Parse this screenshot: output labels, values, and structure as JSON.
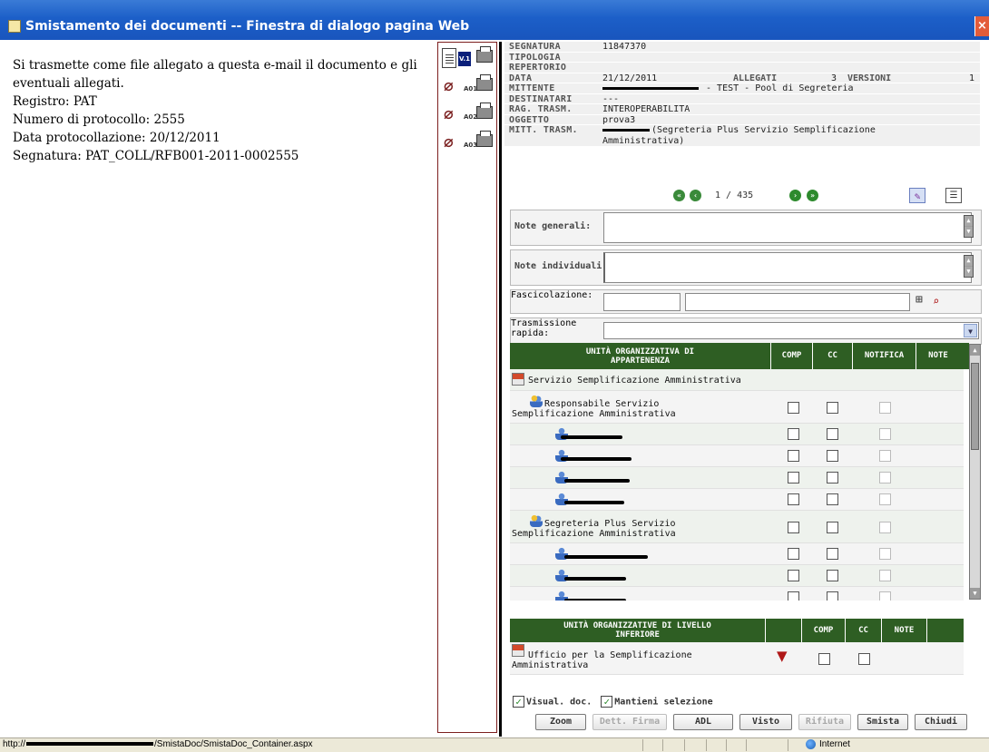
{
  "window": {
    "title": "Smistamento dei documenti -- Finestra di dialogo pagina Web",
    "close_glyph": "×"
  },
  "document": {
    "lines": [
      "Si trasmette come file allegato a questa e-mail il documento e gli",
      "eventuali allegati.",
      "Registro: PAT",
      "Numero di protocollo: 2555",
      "Data protocollazione: 20/12/2011",
      "Segnatura: PAT_COLL/RFB001-2011-0002555"
    ]
  },
  "attachments": [
    {
      "label": "V.1"
    },
    {
      "label": "A01"
    },
    {
      "label": "A02"
    },
    {
      "label": "A03"
    }
  ],
  "meta": {
    "segnatura_k": "SEGNATURA",
    "segnatura_v": "11847370",
    "tipologia_k": "TIPOLOGIA",
    "repertorio_k": "REPERTORIO",
    "data_k": "DATA",
    "data_v": "21/12/2011",
    "allegati_k": "ALLEGATI",
    "allegati_v": "3",
    "versioni_k": "VERSIONI",
    "versioni_v": "1",
    "mittente_k": "MITTENTE",
    "mittente_v": " - TEST - Pool di Segreteria",
    "destinatari_k": "DESTINATARI",
    "destinatari_v": "---",
    "ragtrasm_k": "RAG. TRASM.",
    "ragtrasm_v": "INTEROPERABILITA",
    "oggetto_k": "OGGETTO",
    "oggetto_v": "prova3",
    "mitttrasm_k": "MITT. TRASM.",
    "mitttrasm_v1": "(Segreteria Plus Servizio Semplificazione",
    "mitttrasm_v2": "Amministrativa)"
  },
  "nav": {
    "first": "«",
    "prev": "‹",
    "count": "1 / 435",
    "next": "›",
    "last": "»"
  },
  "form": {
    "note_generali": "Note generali:",
    "note_individuali": "Note individuali:",
    "fascicolazione": "Fascicolazione:",
    "trasmissione_rapida_1": "Trasmissione",
    "trasmissione_rapida_2": "rapida:"
  },
  "grid1": {
    "headers": {
      "unit_1": "UNITÀ ORGANIZZATIVA DI",
      "unit_2": "APPARTENENZA",
      "comp": "COMP",
      "cc": "CC",
      "notifica": "NOTIFICA",
      "note": "NOTE"
    },
    "rows": [
      {
        "name": "Servizio Semplificazione Amministrativa"
      },
      {
        "name_1": "Responsabile Servizio",
        "name_2": "Semplificazione Amministrativa"
      },
      {
        "name": ""
      },
      {
        "name": ""
      },
      {
        "name": ""
      },
      {
        "name": ""
      },
      {
        "name_1": "Segreteria Plus Servizio",
        "name_2": "Semplificazione Amministrativa"
      },
      {
        "name": ""
      },
      {
        "name": ""
      },
      {
        "name": ""
      }
    ]
  },
  "grid2": {
    "headers": {
      "unit_1": "UNITÀ ORGANIZZATIVE DI LIVELLO",
      "unit_2": "INFERIORE",
      "comp": "COMP",
      "cc": "CC",
      "note": "NOTE"
    },
    "rows": [
      {
        "name_1": "Ufficio per la Semplificazione",
        "name_2": "Amministrativa"
      }
    ]
  },
  "options": {
    "visual_doc": "Visual. doc.",
    "mantieni": "Mantieni selezione"
  },
  "buttons": {
    "zoom": "Zoom",
    "dett_firma": "Dett. Firma",
    "adl": "ADL",
    "visto": "Visto",
    "rifiuta": "Rifiuta",
    "smista": "Smista",
    "chiudi": "Chiudi"
  },
  "statusbar": {
    "url_prefix": "http://",
    "url_suffix": "/SmistaDoc/SmistaDoc_Container.aspx",
    "zone": "Internet"
  },
  "colors": {
    "titlebar": "#1c5fc8",
    "grid_header": "#2e5e23",
    "nav_button": "#2d8a2d"
  }
}
